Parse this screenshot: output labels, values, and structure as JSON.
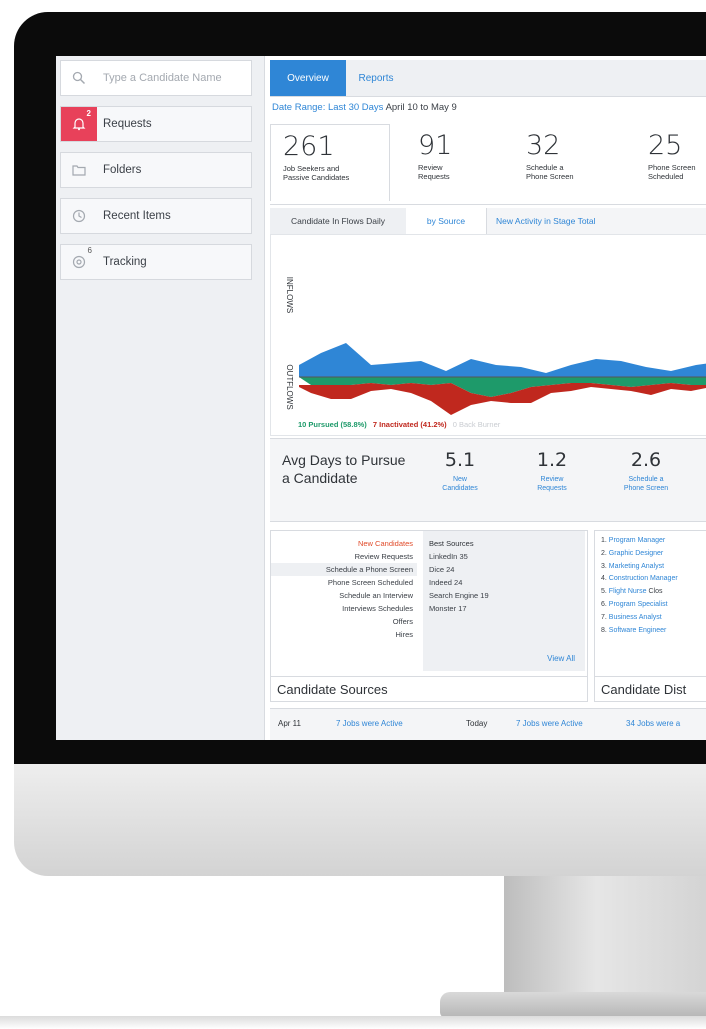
{
  "sidebar": {
    "search_placeholder": "Type a Candidate Name",
    "requests_badge": "2",
    "tracking_badge": "6",
    "items": [
      {
        "label": "Requests",
        "icon": "bell-icon"
      },
      {
        "label": "Folders",
        "icon": "folder-icon"
      },
      {
        "label": "Recent Items",
        "icon": "clock-icon"
      },
      {
        "label": "Tracking",
        "icon": "target-icon"
      }
    ]
  },
  "tabs": {
    "overview": "Overview",
    "reports": "Reports"
  },
  "date_range": {
    "label": "Date Range: Last 30 Days",
    "value": "April 10 to May 9"
  },
  "stats": [
    {
      "num": "261",
      "l1": "Job Seekers and",
      "l2": "Passive Candidates"
    },
    {
      "num": "91",
      "l1": "Review",
      "l2": "Requests"
    },
    {
      "num": "32",
      "l1": "Schedule a",
      "l2": "Phone Screen"
    },
    {
      "num": "25",
      "l1": "Phone Screen",
      "l2": "Scheduled"
    }
  ],
  "subtabs": [
    "Candidate In Flows Daily",
    "by Source",
    "New Activity in Stage Total"
  ],
  "chart": {
    "inflows_label": "INFLOWS",
    "outflows_label": "OUTFLOWS",
    "legend_pursued": "10 Pursued (58.8%)",
    "legend_inactivated": "7 Inactivated (41.2%)",
    "legend_third": "0 Back Burner"
  },
  "avg": {
    "title_1": "Avg Days to Pursue",
    "title_2": "a Candidate",
    "items": [
      {
        "num": "5.1",
        "l1": "New",
        "l2": "Candidates"
      },
      {
        "num": "1.2",
        "l1": "Review",
        "l2": "Requests"
      },
      {
        "num": "2.6",
        "l1": "Schedule a",
        "l2": "Phone Screen"
      }
    ]
  },
  "funnel": [
    "New Candidates",
    "Review Requests",
    "Schedule a Phone Screen",
    "Phone Screen Scheduled",
    "Schedule an Interview",
    "Interviews Schedules",
    "Offers",
    "Hires"
  ],
  "best_sources": {
    "title": "Best Sources",
    "items": [
      {
        "name": "LinkedIn",
        "count": "35"
      },
      {
        "name": "Dice",
        "count": "24"
      },
      {
        "name": "Indeed",
        "count": "24"
      },
      {
        "name": "Search Engine",
        "count": "19"
      },
      {
        "name": "Monster",
        "count": "17"
      }
    ],
    "view_all": "View All"
  },
  "candidate_sources_title": "Candidate Sources",
  "jobs": {
    "items": [
      {
        "n": "1.",
        "name": "Program Manager",
        "extra": ""
      },
      {
        "n": "2.",
        "name": "Graphic Designer",
        "extra": ""
      },
      {
        "n": "3.",
        "name": "Marketing Analyst",
        "extra": ""
      },
      {
        "n": "4.",
        "name": "Construction Manager",
        "extra": ""
      },
      {
        "n": "5.",
        "name": "Flight Nurse",
        "extra": "Clos"
      },
      {
        "n": "6.",
        "name": "Program Specialist",
        "extra": ""
      },
      {
        "n": "7.",
        "name": "Business Analyst",
        "extra": ""
      },
      {
        "n": "8.",
        "name": "Software Engineer",
        "extra": ""
      }
    ],
    "title": "Candidate Dist"
  },
  "activity": {
    "date1": "Apr 11",
    "text1": "7 Jobs were Active",
    "date2": "Today",
    "text2": "7 Jobs were Active",
    "text3": "34 Jobs were a"
  },
  "colors": {
    "accent": "#2f86d6",
    "red": "#e8415a",
    "inflow": "#2f86d6",
    "outflow_red": "#c0281e",
    "outflow_green": "#1e9a6a"
  }
}
